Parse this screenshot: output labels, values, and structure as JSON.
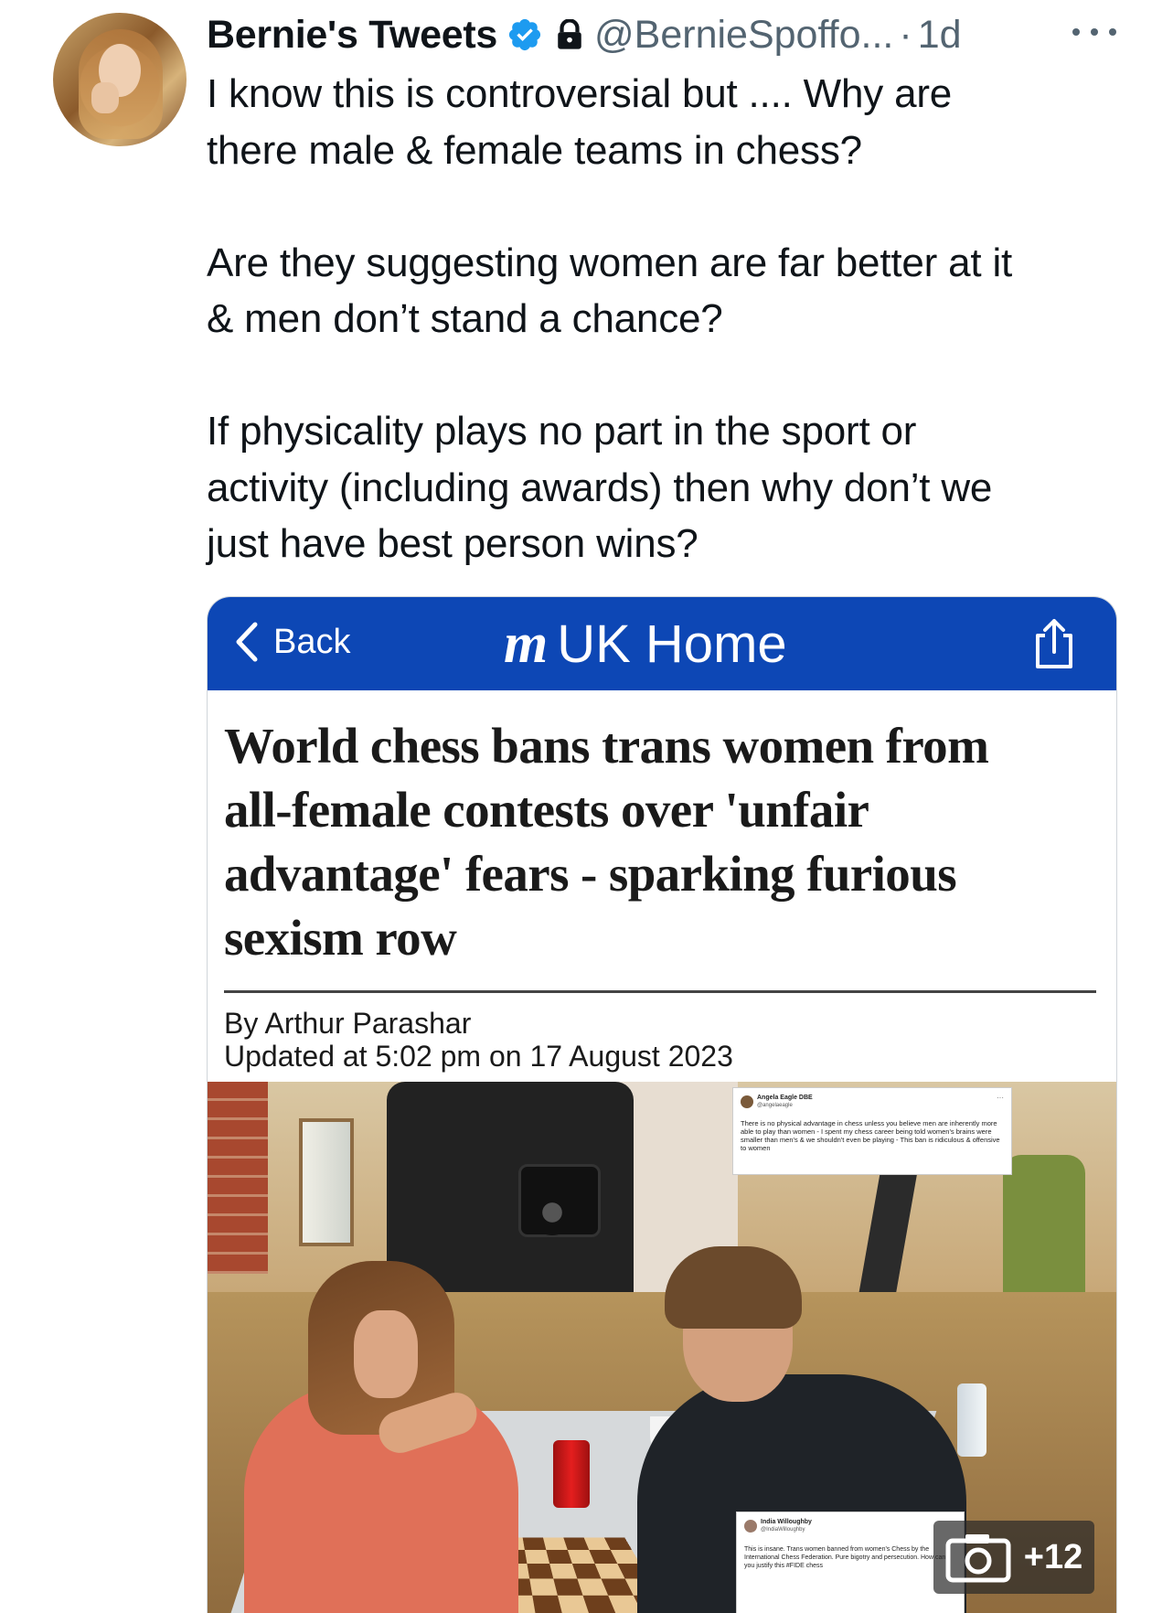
{
  "tweet": {
    "display_name": "Bernie's Tweets",
    "handle": "@BernieSpoffo...",
    "separator": "·",
    "time": "1d",
    "paragraphs": [
      [
        "I know this is controversial but .... Why are",
        "there male & female teams in chess?"
      ],
      [
        "Are they suggesting women are far better at it",
        "& men don’t stand a chance?"
      ],
      [
        "If physicality plays no part in the sport or",
        "activity (including awards) then why don’t we",
        "just have best person wins?"
      ]
    ],
    "icons": {
      "verified": "verified-badge-icon",
      "lock": "lock-icon",
      "more": "more-dots-icon"
    }
  },
  "card": {
    "navbar": {
      "back_label": "Back",
      "logo_mark": "m",
      "logo_text": "UK Home",
      "share_icon": "share-icon",
      "color": "#0d47b5"
    },
    "headline_lines": [
      "World chess bans trans women from",
      "all-female contests over 'unfair",
      "advantage' fears - sparking furious",
      "sexism row"
    ],
    "byline": "By Arthur Parashar",
    "updated": "Updated at 5:02 pm on 17 August 2023",
    "photo": {
      "inset_tweet_1": {
        "name": "Angela Eagle DBE",
        "handle": "@angelaeagle",
        "text": "There is no physical advantage in chess unless you believe men are inherently more able to play than women - I spent my chess career being told women's brains were smaller than men's & we shouldn't even be playing - This ban is ridiculous & offensive to women"
      },
      "inset_tweet_2": {
        "name": "India Willoughby",
        "handle": "@IndiaWilloughby",
        "text": "This is insane. Trans women banned from women's Chess by the International Chess Federation. Pure bigotry and persecution. How can you justify this #FIDE chess"
      },
      "gallery_count": "+12",
      "gallery_icon": "camera-icon"
    }
  }
}
